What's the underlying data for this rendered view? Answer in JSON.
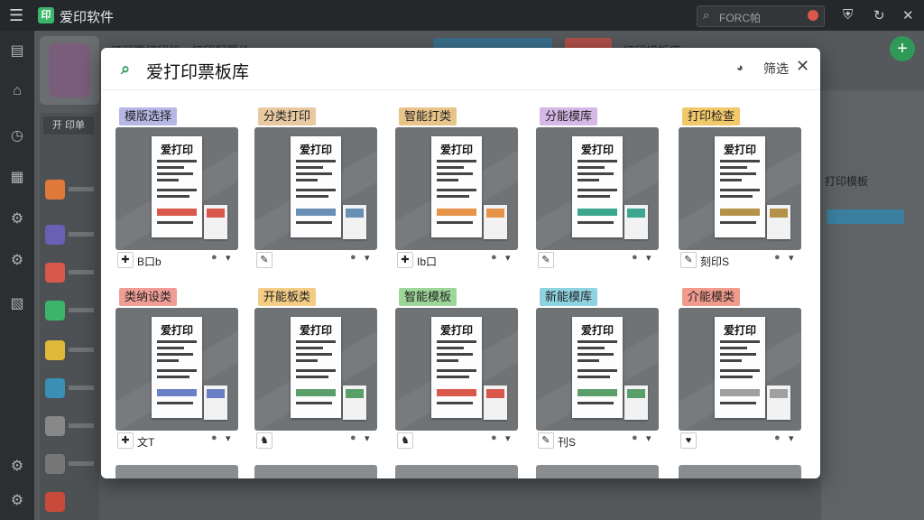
{
  "app": {
    "title": "爱印软件",
    "logo_letter": "印"
  },
  "topbar": {
    "search_placeholder": "FORC帕"
  },
  "icons": {
    "hamburger": "☰",
    "search": "⌕",
    "shield": "⛨",
    "refresh": "↻",
    "close": "✕",
    "rail": [
      "▤",
      "⌂",
      "◷",
      "▦",
      "⚙",
      "⚙",
      "▧",
      "⚙",
      "⚙"
    ]
  },
  "background": {
    "top_texts": [
      "订阅票打印机",
      "打印配置价",
      "打印模板库"
    ],
    "side_tab": "开 印单",
    "right_heading": "打印模板"
  },
  "modal": {
    "title": "爱打印票板库",
    "filter_label": "筛选",
    "cards": [
      {
        "tag": "模版选择",
        "tag_color": "#b7b7e6",
        "receipt_title": "爱打印",
        "accent": "#d8584b",
        "icon": "✚",
        "name": "B口b"
      },
      {
        "tag": "分类打印",
        "tag_color": "#e9c9a2",
        "receipt_title": "爱打印",
        "accent": "#6a8fb5",
        "icon": "✎",
        "name": ""
      },
      {
        "tag": "智能打类",
        "tag_color": "#e8c48a",
        "receipt_title": "爱打印",
        "accent": "#e8934a",
        "icon": "✚",
        "name": "Ib口"
      },
      {
        "tag": "分能模库",
        "tag_color": "#d6b8e6",
        "receipt_title": "爱打印",
        "accent": "#3aa78e",
        "icon": "✎",
        "name": ""
      },
      {
        "tag": "打印检查",
        "tag_color": "#f1c86a",
        "receipt_title": "爱打印",
        "accent": "#b4924a",
        "icon": "✎",
        "name": "刻印S"
      },
      {
        "tag": "类纳设类",
        "tag_color": "#f09d96",
        "receipt_title": "爱打印",
        "accent": "#6a7fc5",
        "icon": "✚",
        "name": "文T"
      },
      {
        "tag": "开能板类",
        "tag_color": "#f3cc85",
        "receipt_title": "爱打印",
        "accent": "#5a9f6a",
        "icon": "♞",
        "name": ""
      },
      {
        "tag": "智能模板",
        "tag_color": "#9ed69a",
        "receipt_title": "爱打印",
        "accent": "#d8584b",
        "icon": "♞",
        "name": ""
      },
      {
        "tag": "新能模库",
        "tag_color": "#8fd3e2",
        "receipt_title": "爱打印",
        "accent": "#5a9f6a",
        "icon": "✎",
        "name": "刊S"
      },
      {
        "tag": "介能模类",
        "tag_color": "#f09b8c",
        "receipt_title": "爱打印",
        "accent": "#a0a0a0",
        "icon": "♥",
        "name": ""
      }
    ]
  }
}
